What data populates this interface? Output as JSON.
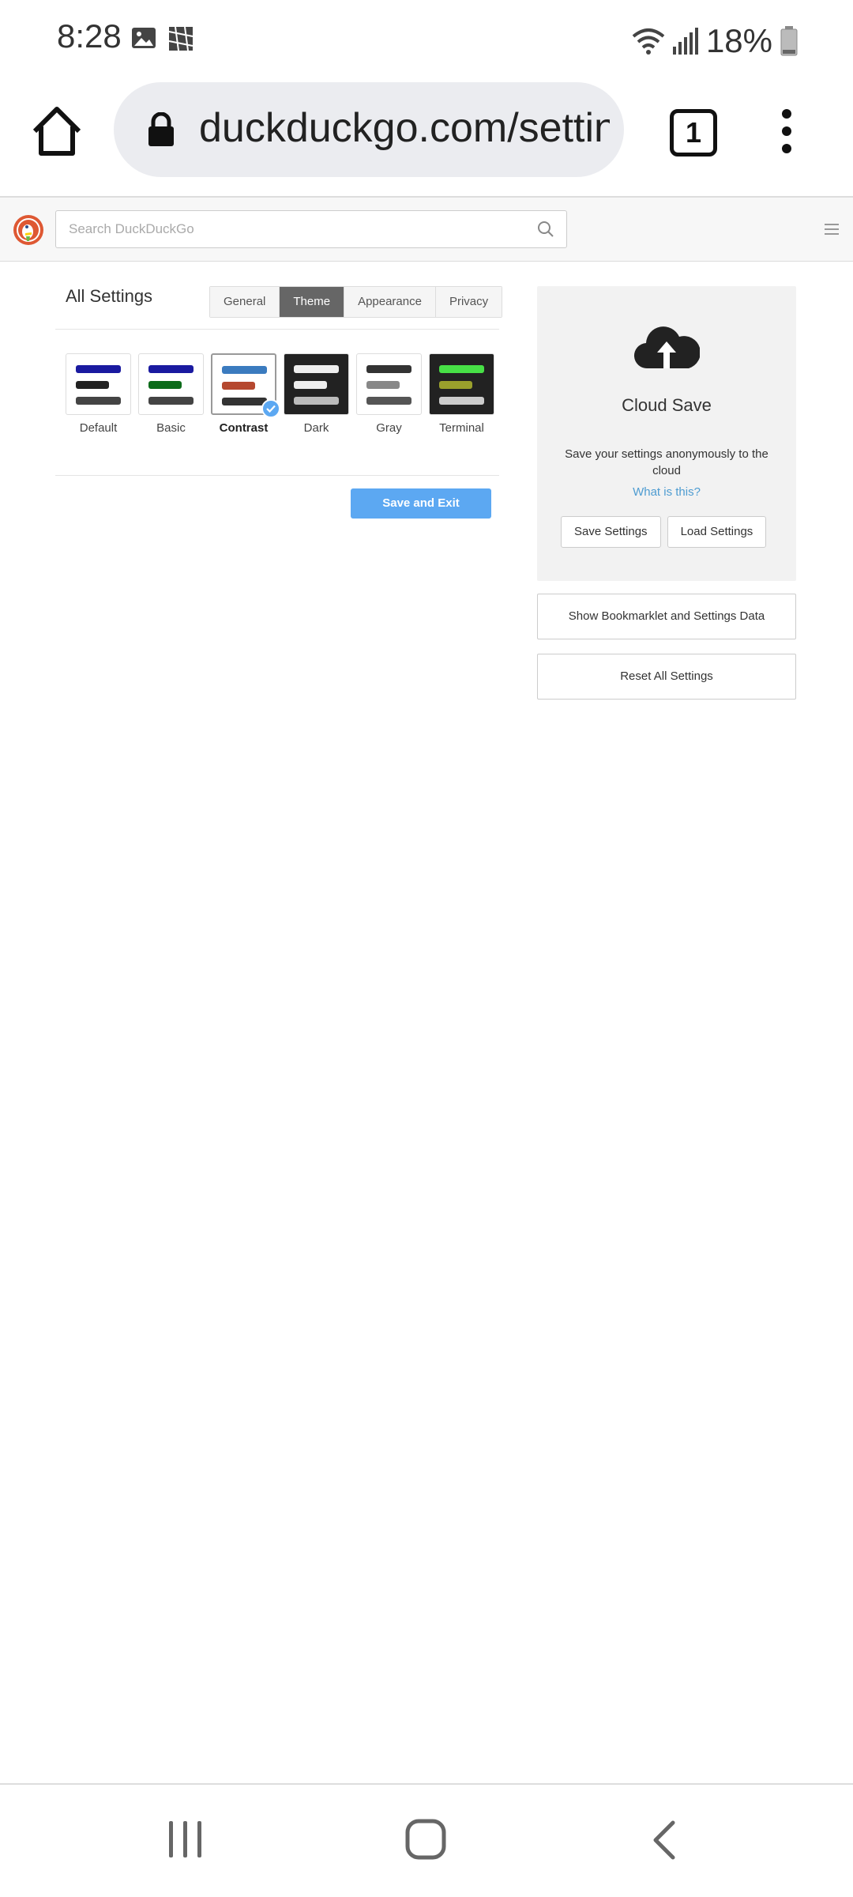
{
  "status_bar": {
    "time": "8:28",
    "battery": "18%"
  },
  "browser": {
    "url": "duckduckgo.com/settings",
    "tab_count": "1"
  },
  "ddg_header": {
    "search_placeholder": "Search DuckDuckGo"
  },
  "settings": {
    "title": "All Settings",
    "tabs": [
      "General",
      "Theme",
      "Appearance",
      "Privacy"
    ],
    "active_tab": "Theme",
    "themes": [
      {
        "label": "Default",
        "bg": "#ffffff",
        "bars": [
          "#1a1aa0",
          "#222222",
          "#444444"
        ]
      },
      {
        "label": "Basic",
        "bg": "#ffffff",
        "bars": [
          "#1a1aa0",
          "#0c6b1a",
          "#444444"
        ]
      },
      {
        "label": "Contrast",
        "bg": "#ffffff",
        "bars": [
          "#3b7bbf",
          "#b5482f",
          "#333333"
        ]
      },
      {
        "label": "Dark",
        "bg": "#222222",
        "bars": [
          "#eeeeee",
          "#eeeeee",
          "#bbbbbb"
        ]
      },
      {
        "label": "Gray",
        "bg": "#ffffff",
        "bars": [
          "#333333",
          "#888888",
          "#555555"
        ]
      },
      {
        "label": "Terminal",
        "bg": "#222222",
        "bars": [
          "#47e046",
          "#9aa02c",
          "#cccccc"
        ]
      }
    ],
    "selected_theme": "Contrast",
    "save_exit": "Save and Exit"
  },
  "cloud_save": {
    "title": "Cloud Save",
    "description": "Save your settings anonymously to the cloud",
    "link": "What is this?",
    "save_button": "Save Settings",
    "load_button": "Load Settings"
  },
  "side_buttons": {
    "bookmarklet": "Show Bookmarklet and Settings Data",
    "reset": "Reset All Settings"
  },
  "colors": {
    "accent_button": "#5ca8f2",
    "link": "#4e9cd1",
    "active_tab": "#666666"
  }
}
